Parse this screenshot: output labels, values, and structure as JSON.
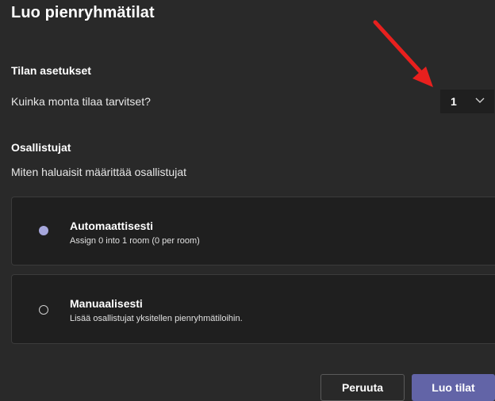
{
  "dialog": {
    "title": "Luo pienryhmätilat"
  },
  "room_settings": {
    "heading": "Tilan asetukset",
    "question": "Kuinka monta tilaa tarvitset?",
    "room_count": "1"
  },
  "participants": {
    "heading": "Osallistujat",
    "question": "Miten haluaisit määrittää osallistujat",
    "options": [
      {
        "title": "Automaattisesti",
        "subtitle": "Assign 0 into 1 room (0 per room)",
        "selected": true
      },
      {
        "title": "Manuaalisesti",
        "subtitle": "Lisää osallistujat yksitellen pienryhmätiloihin.",
        "selected": false
      }
    ]
  },
  "footer": {
    "cancel_label": "Peruuta",
    "create_label": "Luo tilat"
  },
  "colors": {
    "background": "#292929",
    "card": "#1f1f1f",
    "accent": "#6264a7",
    "radio_selected": "#a6a7dc",
    "annotation_arrow": "#e8201e"
  }
}
